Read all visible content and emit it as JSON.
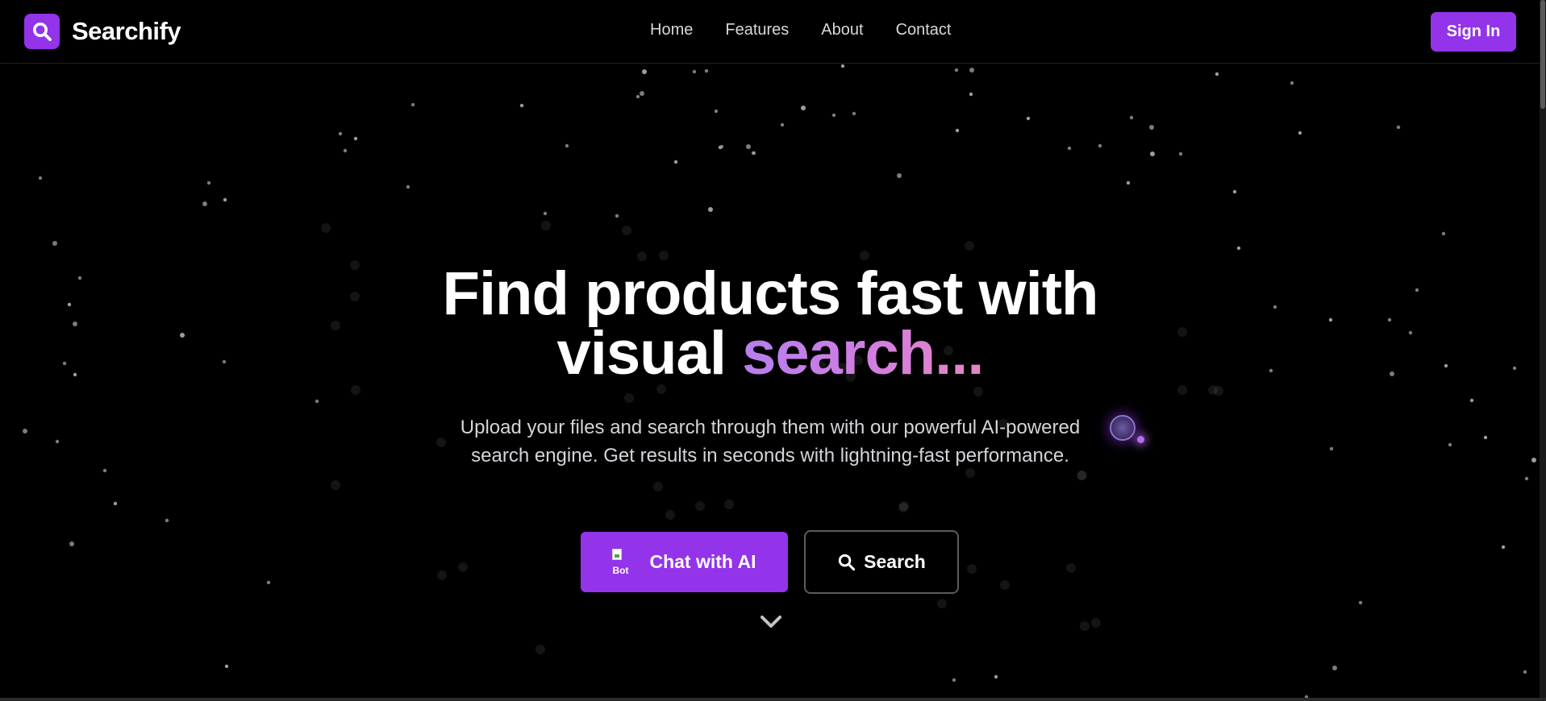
{
  "header": {
    "brand": {
      "name": "Searchify",
      "icon": "search-icon"
    },
    "nav": {
      "items": [
        {
          "label": "Home"
        },
        {
          "label": "Features"
        },
        {
          "label": "About"
        },
        {
          "label": "Contact"
        }
      ]
    },
    "sign_in_label": "Sign In"
  },
  "hero": {
    "title_line1": "Find products fast with",
    "title_line2_plain": "visual",
    "title_line2_accent": "search...",
    "subtitle": "Upload your files and search through them with our powerful AI-powered search engine. Get results in seconds with lightning-fast performance.",
    "chat_button": {
      "label": "Chat with AI",
      "broken_image_alt": "Bot"
    },
    "search_button": {
      "label": "Search",
      "icon": "search-icon"
    },
    "scroll_cue_icon": "chevron-down-icon"
  },
  "colors": {
    "background": "#000000",
    "accent": "#9333ea",
    "gradient_start": "#b57ef0",
    "gradient_end": "#e486c2",
    "nav_text": "#d7d7dc",
    "star": "#a5a5a5"
  }
}
